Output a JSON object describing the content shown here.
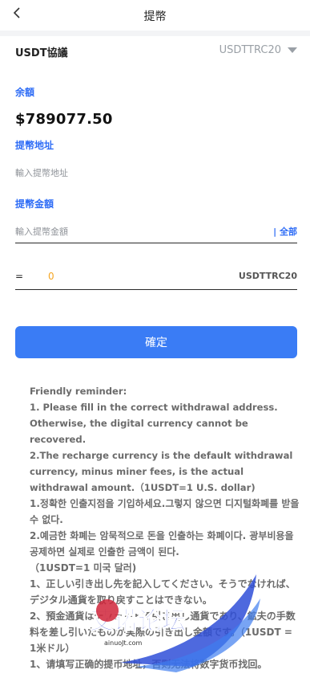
{
  "header": {
    "title": "提幣",
    "back_icon": "chevron-left-icon"
  },
  "usdt": {
    "label": "USDT協議",
    "selected": "USDTTRC20",
    "dropdown_icon": "caret-down-icon"
  },
  "balance": {
    "label": "余額",
    "value": "$789077.50"
  },
  "address": {
    "label": "提幣地址",
    "placeholder": "輸入提幣地址"
  },
  "amount": {
    "label": "提幣金額",
    "placeholder": "輸入提幣金額",
    "all_link": "| 全部"
  },
  "conversion": {
    "equals": "=",
    "value": "0",
    "unit": "USDTTRC20"
  },
  "confirm_button": "確定",
  "reminder": [
    "Friendly reminder:",
    "1. Please fill in the correct withdrawal address. Otherwise, the digital currency cannot be recovered.",
    "2.The recharge currency is the default withdrawal currency, minus miner fees, is the actual withdrawal amount.（1USDT=1 U.S. dollar)",
    "1.정확한 인출지점을 기입하세요.그렇지 않으면 디지털화폐를 받을수 없다.",
    "2.예금한 화폐는 암묵적으로 돈을 인출하는 화폐이다. 광부비용을 공제하면 실제로 인출한 금액이 된다.",
    "（1USDT=1 미국 달러)",
    "1、正しい引き出し先を記入してください。そうでなければ、デジタル通貨を取り戻すことはできない。",
    "2、預金通貨はデフォルトで引き出し通貨であり、鉱夫の手数料を差し引いたものが実際の引き出し金額です。（1USDT = 1米ドル）",
    "1、请填写正确的提币地址，否则无法将数字货币找回。"
  ],
  "watermark": {
    "text": "艾诺论坛",
    "subtext": "ainuoJt.com"
  }
}
